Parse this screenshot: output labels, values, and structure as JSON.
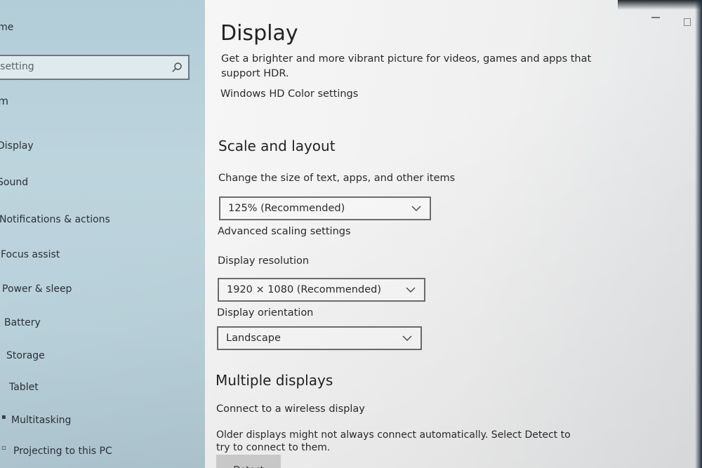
{
  "window": {
    "controls": {
      "minimize": "minimize",
      "maximize": "maximize"
    }
  },
  "sidebar": {
    "home_label": "Home",
    "search_placeholder": "Find a setting",
    "section_label": "System",
    "items": [
      {
        "label": "Display",
        "icon": "monitor-icon"
      },
      {
        "label": "Sound",
        "icon": "speaker-icon"
      },
      {
        "label": "Notifications & actions",
        "icon": "notification-icon"
      },
      {
        "label": "Focus assist",
        "icon": "moon-icon"
      },
      {
        "label": "Power & sleep",
        "icon": "power-icon"
      },
      {
        "label": "Battery",
        "icon": "battery-icon"
      },
      {
        "label": "Storage",
        "icon": "storage-icon"
      },
      {
        "label": "Tablet",
        "icon": "tablet-icon"
      },
      {
        "label": "Multitasking",
        "icon": "multitasking-icon"
      },
      {
        "label": "Projecting to this PC",
        "icon": "projecting-icon"
      }
    ]
  },
  "main": {
    "title": "Display",
    "hdr": {
      "description_line1": "Get a brighter and more vibrant picture for videos, games and apps that",
      "description_line2": "support HDR.",
      "link": "Windows HD Color settings"
    },
    "scale_layout": {
      "heading": "Scale and layout",
      "size_label": "Change the size of text, apps, and other items",
      "size_value": "125% (Recommended)",
      "advanced_link": "Advanced scaling settings",
      "resolution_label": "Display resolution",
      "resolution_value": "1920 × 1080 (Recommended)",
      "orientation_label": "Display orientation",
      "orientation_value": "Landscape"
    },
    "multiple_displays": {
      "heading": "Multiple displays",
      "wireless_link": "Connect to a wireless display",
      "note_line1": "Older displays might not always connect automatically. Select Detect to",
      "note_line2": "try to connect to them.",
      "detect_label": "Detect"
    }
  }
}
